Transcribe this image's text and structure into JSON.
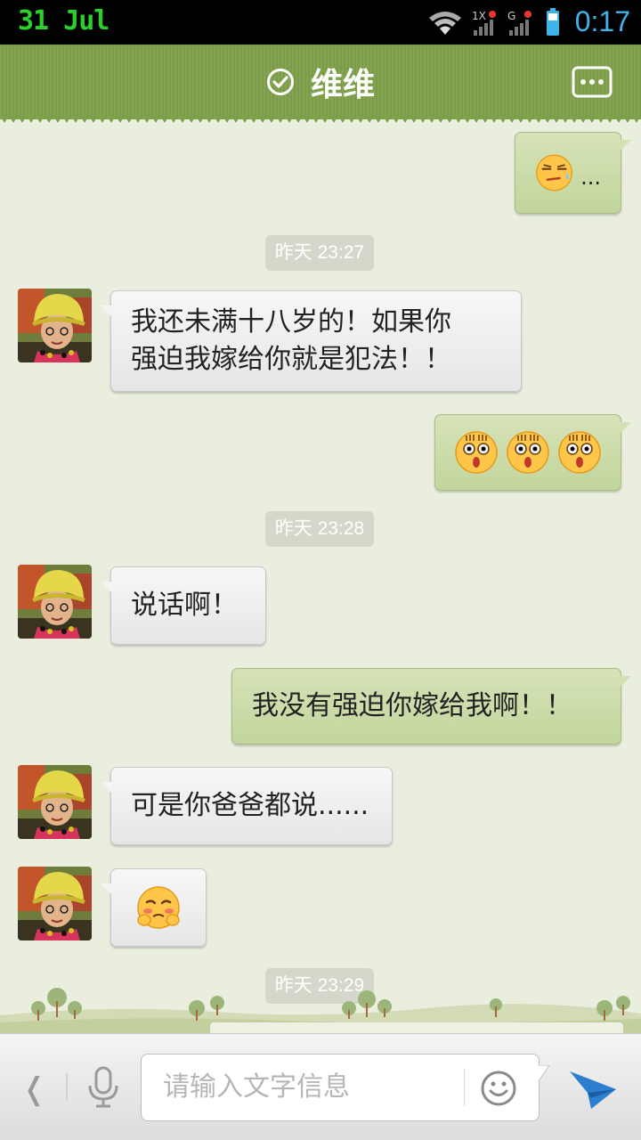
{
  "status_bar": {
    "date": "31 Jul",
    "time": "0:17",
    "icons": [
      "wifi-icon",
      "signal-1x-icon",
      "signal-g-icon",
      "battery-icon"
    ]
  },
  "header": {
    "title": "维维",
    "verified_icon": "check-circle-icon",
    "more_icon": "more-dots-icon",
    "bg_color": "#7fa04a"
  },
  "messages": [
    {
      "id": "m1",
      "side": "out",
      "type": "emoji",
      "emoji": "sweat-face",
      "text": "..."
    },
    {
      "id": "t1",
      "type": "timestamp",
      "text": "昨天 23:27"
    },
    {
      "id": "m2",
      "side": "in",
      "type": "text",
      "lines": [
        "我还未满十八岁的！如果你",
        "强迫我嫁给你就是犯法！！"
      ]
    },
    {
      "id": "m3",
      "side": "out",
      "type": "emoji",
      "emoji": "shocked-face",
      "count": 3
    },
    {
      "id": "t2",
      "type": "timestamp",
      "text": "昨天 23:28"
    },
    {
      "id": "m4",
      "side": "in",
      "type": "text",
      "lines": [
        "说话啊！"
      ]
    },
    {
      "id": "m5",
      "side": "out",
      "type": "text",
      "lines": [
        "我没有强迫你嫁给我啊！！"
      ]
    },
    {
      "id": "m6",
      "side": "in",
      "type": "text",
      "lines": [
        "可是你爸爸都说......"
      ]
    },
    {
      "id": "m7",
      "side": "in",
      "type": "emoji",
      "emoji": "shy-face"
    },
    {
      "id": "t3",
      "type": "timestamp",
      "text": "昨天 23:29"
    }
  ],
  "input_bar": {
    "placeholder": "请输入文字信息",
    "icons": [
      "chevron-left-icon",
      "mic-icon",
      "smiley-icon",
      "send-icon"
    ]
  },
  "colors": {
    "chat_bg": "#e9eedf",
    "bubble_in": "#efefef",
    "bubble_out": "#ccdba9",
    "time_green": "#29d12a",
    "clock_blue": "#3fb4ea"
  }
}
